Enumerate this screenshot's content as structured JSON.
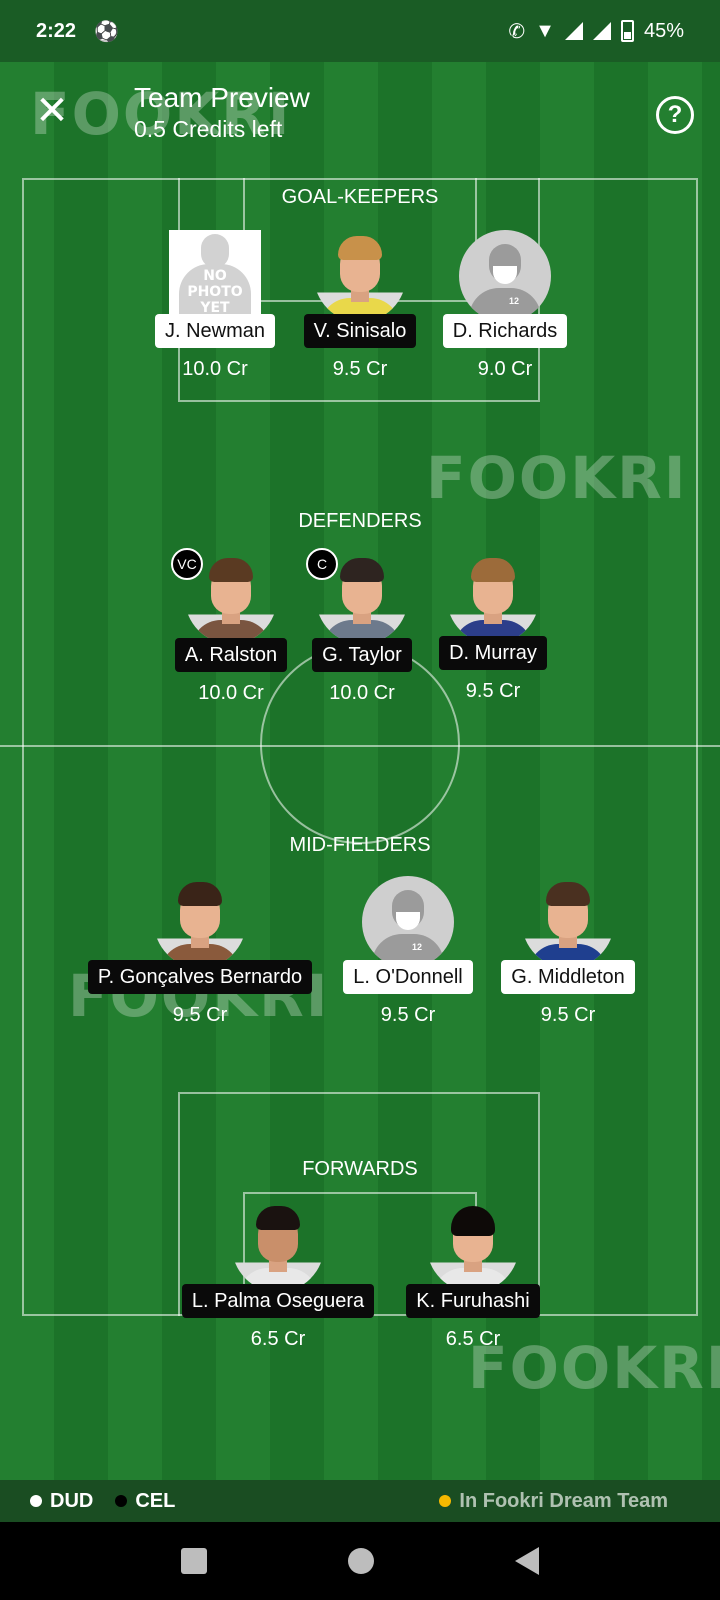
{
  "status_bar": {
    "time": "2:22",
    "battery": "45%",
    "icons": [
      "soccer-ball-icon",
      "wifi-call-icon",
      "wifi-icon",
      "signal-icon",
      "signal-icon",
      "battery-icon"
    ]
  },
  "header": {
    "title": "Team Preview",
    "subtitle": "0.5 Credits left",
    "close_icon": "close-icon",
    "help_label": "?"
  },
  "watermark": "FOOKRI",
  "sections": {
    "goalkeepers": "GOAL-KEEPERS",
    "defenders": "DEFENDERS",
    "midfielders": "MID-FIELDERS",
    "forwards": "FORWARDS"
  },
  "no_photo_text": [
    "NO",
    "PHOTO",
    "YET"
  ],
  "players": {
    "gk1": {
      "name": "J. Newman",
      "credit": "10.0 Cr"
    },
    "gk2": {
      "name": "V. Sinisalo",
      "credit": "9.5 Cr"
    },
    "gk3": {
      "name": "D. Richards",
      "credit": "9.0 Cr"
    },
    "def1": {
      "name": "A. Ralston",
      "credit": "10.0 Cr",
      "badge": "VC"
    },
    "def2": {
      "name": "G. Taylor",
      "credit": "10.0 Cr",
      "badge": "C"
    },
    "def3": {
      "name": "D. Murray",
      "credit": "9.5 Cr"
    },
    "mid1": {
      "name": "P. Gonçalves Bernardo",
      "credit": "9.5 Cr"
    },
    "mid2": {
      "name": "L. O'Donnell",
      "credit": "9.5 Cr"
    },
    "mid3": {
      "name": "G. Middleton",
      "credit": "9.5 Cr"
    },
    "fwd1": {
      "name": "L. Palma Oseguera",
      "credit": "6.5 Cr"
    },
    "fwd2": {
      "name": "K. Furuhashi",
      "credit": "6.5 Cr"
    }
  },
  "legend": {
    "dud": "DUD",
    "cel": "CEL",
    "dream": "In Fookri Dream Team",
    "colors": {
      "dud": "#ffffff",
      "cel": "#000000",
      "dream": "#f5b800"
    }
  },
  "colors": {
    "pitch_light": "#237f30",
    "pitch_dark": "#1c7329"
  }
}
